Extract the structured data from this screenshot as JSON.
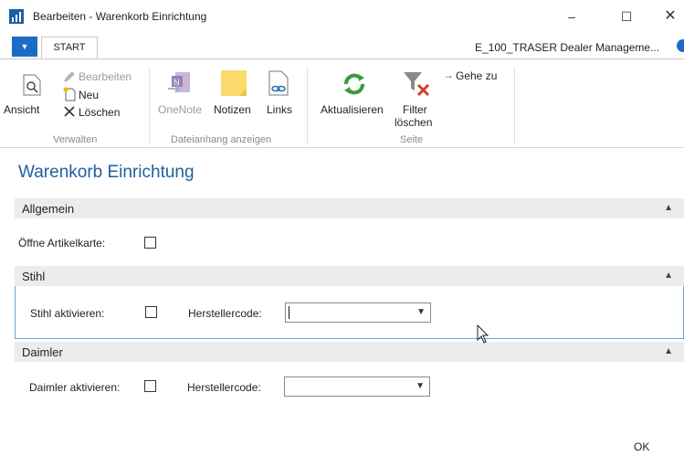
{
  "window": {
    "title": "Bearbeiten - Warenkorb Einrichtung",
    "minimize_glyph": "–",
    "maximize_glyph": "☐",
    "close_glyph": "✕"
  },
  "ribbon": {
    "file_tab_glyph": "▼",
    "start_tab": "START",
    "company": "E_100_TRASER Dealer Manageme...",
    "groups": {
      "verwalten": {
        "label": "Verwalten",
        "ansicht": "Ansicht",
        "bearbeiten": "Bearbeiten",
        "neu": "Neu",
        "loeschen": "Löschen"
      },
      "dateianhang": {
        "label": "Dateianhang anzeigen",
        "onenote": "OneNote",
        "notizen": "Notizen",
        "links": "Links"
      },
      "seite": {
        "label": "Seite",
        "aktualisieren": "Aktualisieren",
        "filter_line1": "Filter",
        "filter_line2": "löschen",
        "gehe_zu": "Gehe zu"
      }
    }
  },
  "page": {
    "title": "Warenkorb Einrichtung",
    "sections": {
      "allgemein": {
        "title": "Allgemein",
        "field_label": "Öffne Artikelkarte:",
        "checked": false
      },
      "stihl": {
        "title": "Stihl",
        "aktivieren_label": "Stihl aktivieren:",
        "aktivieren_checked": false,
        "herstellercode_label": "Herstellercode:",
        "herstellercode_value": ""
      },
      "daimler": {
        "title": "Daimler",
        "aktivieren_label": "Daimler aktivieren:",
        "aktivieren_checked": false,
        "herstellercode_label": "Herstellercode:",
        "herstellercode_value": ""
      }
    },
    "ok_label": "OK"
  },
  "colors": {
    "accent": "#1c6cc4",
    "title": "#1f5f9f",
    "section_header": "#ececec"
  }
}
